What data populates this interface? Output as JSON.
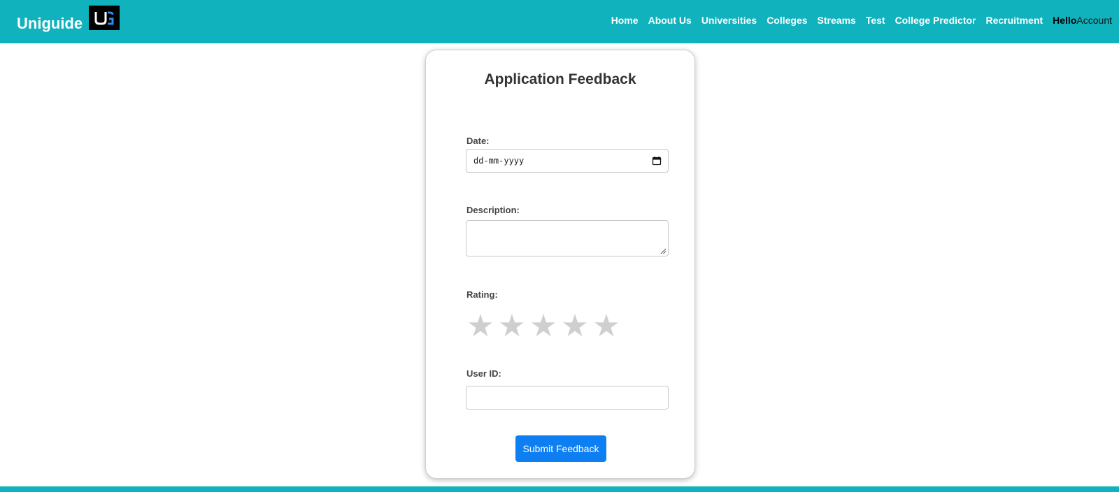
{
  "colors": {
    "brand_teal": "#0fb2bd",
    "submit_blue": "#0d7ff2",
    "star_inactive": "#cfcfcf"
  },
  "navbar": {
    "brand": "Uniguide",
    "logo_text": "UG",
    "links": [
      {
        "label": "Home"
      },
      {
        "label": "About Us"
      },
      {
        "label": "Universities"
      },
      {
        "label": "Colleges"
      },
      {
        "label": "Streams"
      },
      {
        "label": "Test"
      },
      {
        "label": "College Predictor"
      },
      {
        "label": "Recruitment"
      }
    ],
    "account": {
      "hello": "Hello",
      "account": "Account"
    }
  },
  "form": {
    "title": "Application Feedback",
    "date": {
      "label": "Date:",
      "placeholder": "dd-mm-yyyy",
      "icon": "calendar-icon"
    },
    "description": {
      "label": "Description:",
      "value": ""
    },
    "rating": {
      "label": "Rating:",
      "value": 0,
      "max": 5,
      "star_glyph": "★"
    },
    "user_id": {
      "label": "User ID:",
      "value": ""
    },
    "submit_label": "Submit Feedback"
  }
}
